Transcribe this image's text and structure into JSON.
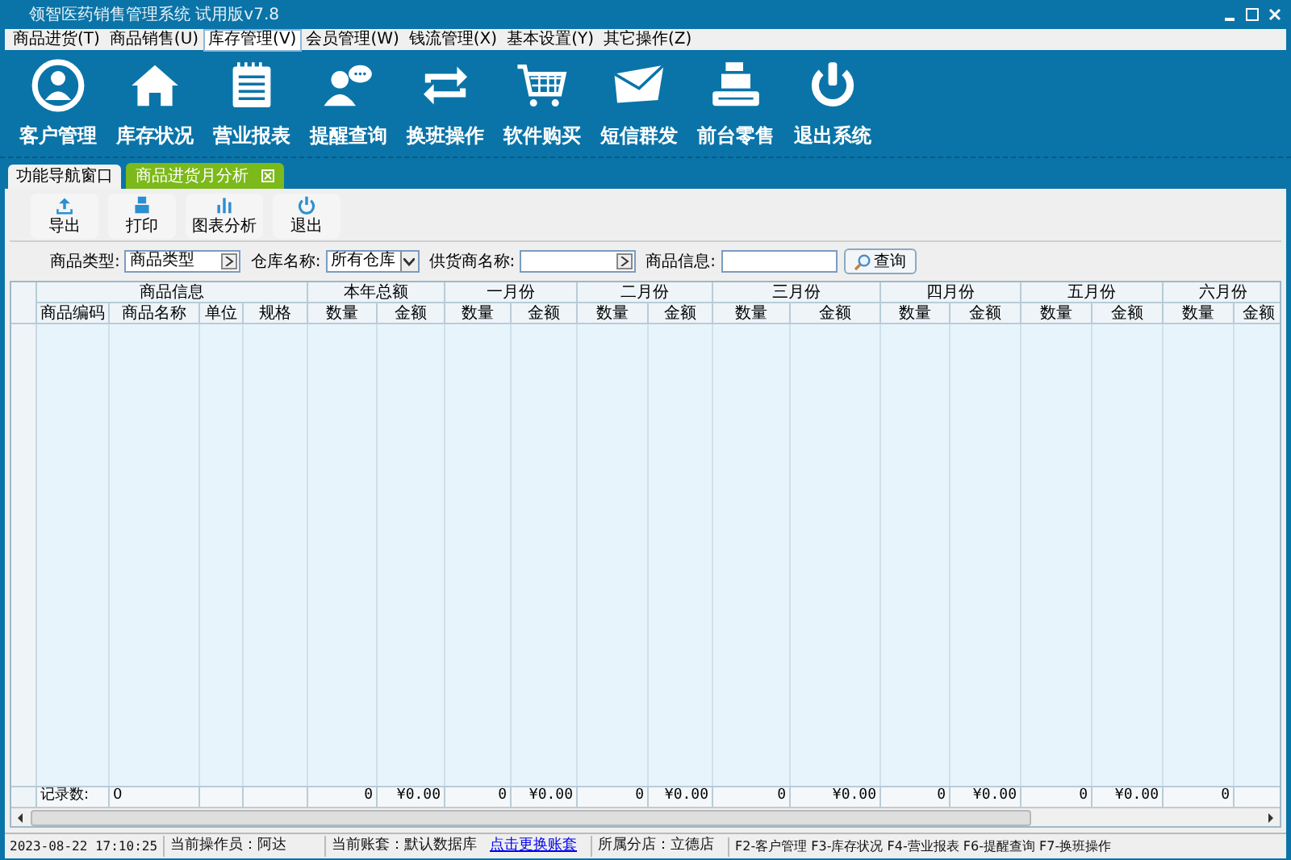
{
  "window": {
    "title": "领智医药销售管理系统 试用版v7.8"
  },
  "menu": [
    {
      "label": "商品进货(T)",
      "selected": false
    },
    {
      "label": "商品销售(U)",
      "selected": false
    },
    {
      "label": "库存管理(V)",
      "selected": true
    },
    {
      "label": "会员管理(W)",
      "selected": false
    },
    {
      "label": "钱流管理(X)",
      "selected": false
    },
    {
      "label": "基本设置(Y)",
      "selected": false
    },
    {
      "label": "其它操作(Z)",
      "selected": false
    }
  ],
  "toolbar": [
    "客户管理",
    "库存状况",
    "营业报表",
    "提醒查询",
    "换班操作",
    "软件购买",
    "短信群发",
    "前台零售",
    "退出系统"
  ],
  "tabs": [
    {
      "label": "功能导航窗口",
      "selected": false,
      "closable": false
    },
    {
      "label": "商品进货月分析",
      "selected": true,
      "closable": true
    }
  ],
  "actions": [
    "导出",
    "打印",
    "图表分析",
    "退出"
  ],
  "filters": [
    {
      "kind": "picker",
      "label": "商品类型:",
      "value": "商品类型"
    },
    {
      "kind": "select",
      "label": "仓库名称:",
      "value": "所有仓库"
    },
    {
      "kind": "picker",
      "label": "供货商名称:"
    },
    {
      "kind": "text",
      "label": "商品信息:"
    }
  ],
  "search_button": "查询",
  "table": {
    "groups": [
      {
        "label": "商品信息",
        "columns": [
          "商品编码",
          "商品名称",
          "单位",
          "规格"
        ]
      },
      {
        "label": "本年总额",
        "columns": [
          "数量",
          "金额"
        ]
      },
      {
        "label": "一月份",
        "columns": [
          "数量",
          "金额"
        ]
      },
      {
        "label": "二月份",
        "columns": [
          "数量",
          "金额"
        ]
      },
      {
        "label": "三月份",
        "columns": [
          "数量",
          "金额"
        ]
      },
      {
        "label": "四月份",
        "columns": [
          "数量",
          "金额"
        ]
      },
      {
        "label": "五月份",
        "columns": [
          "数量",
          "金额"
        ]
      },
      {
        "label": "六月份",
        "columns": [
          "数量",
          "金额"
        ]
      }
    ],
    "footer": {
      "label": "记录数:",
      "count": "0",
      "totals": [
        "0",
        "¥0.00",
        "0",
        "¥0.00",
        "0",
        "¥0.00",
        "0",
        "¥0.00",
        "0",
        "¥0.00",
        "0",
        "¥0.00",
        "0"
      ]
    }
  },
  "status_bar": {
    "datetime": "2023-08-22 17:10:25",
    "operator": "当前操作员：阿达",
    "account": "当前账套：默认数据库",
    "link": "点击更换账套",
    "branch": "所属分店：立德店",
    "shortcuts": "F2-客户管理 F3-库存状况 F4-营业报表 F6-提醒查询 F7-换班操作"
  }
}
